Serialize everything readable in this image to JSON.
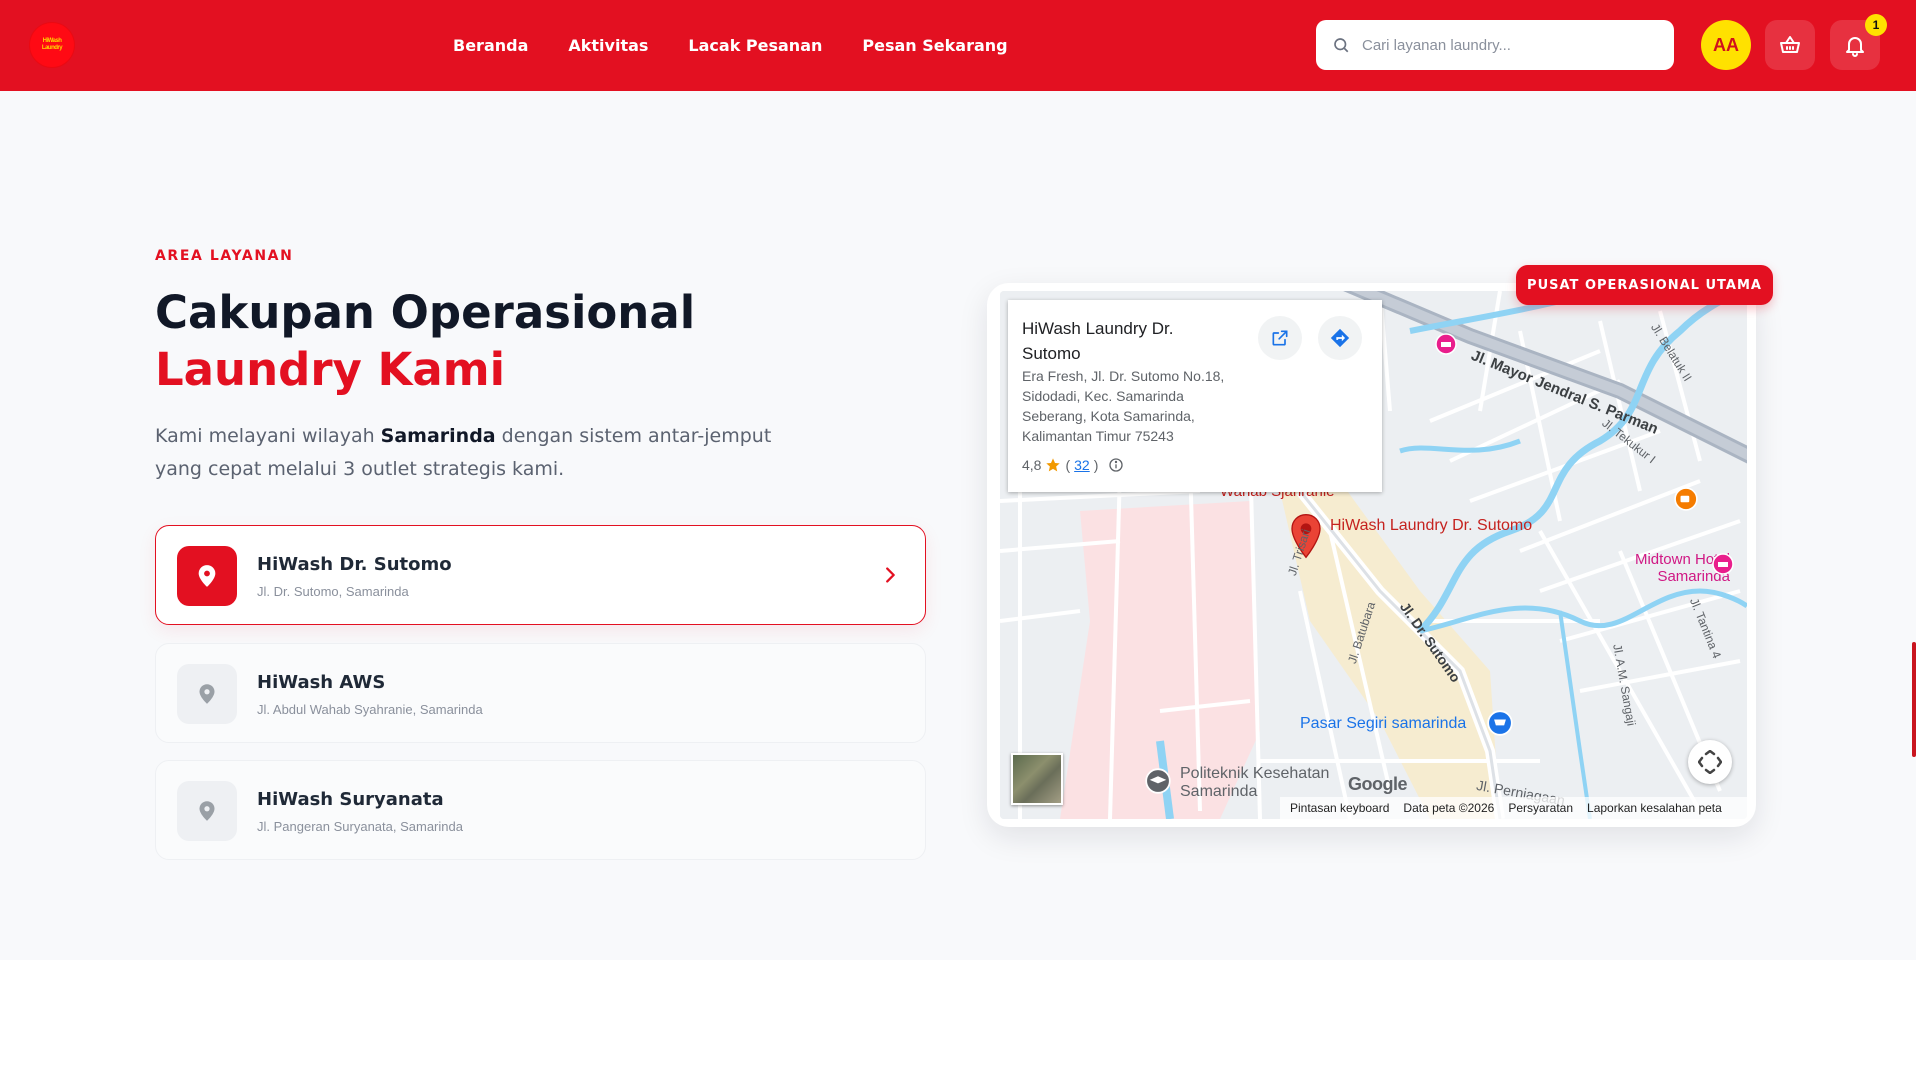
{
  "nav": {
    "logo_text": "HiWash Laundry",
    "menu": [
      "Beranda",
      "Aktivitas",
      "Lacak Pesanan",
      "Pesan Sekarang"
    ],
    "search_placeholder": "Cari layanan laundry...",
    "avatar_initials": "AA",
    "notification_count": "1"
  },
  "section": {
    "eyebrow": "AREA LAYANAN",
    "title_line1": "Cakupan Operasional",
    "title_line2": "Laundry Kami",
    "lead_prefix": "Kami melayani wilayah ",
    "lead_bold": "Samarinda",
    "lead_suffix": " dengan sistem antar-jemput yang cepat melalui 3 outlet strategis kami."
  },
  "outlets": [
    {
      "name": "HiWash Dr. Sutomo",
      "address": "Jl. Dr. Sutomo, Samarinda",
      "active": true
    },
    {
      "name": "HiWash AWS",
      "address": "Jl. Abdul Wahab Syahranie, Samarinda",
      "active": false
    },
    {
      "name": "HiWash Suryanata",
      "address": "Jl. Pangeran Suryanata, Samarinda",
      "active": false
    }
  ],
  "map": {
    "badge": "PUSAT OPERASIONAL UTAMA",
    "info": {
      "name": "HiWash Laundry Dr. Sutomo",
      "address": "Era Fresh, Jl. Dr. Sutomo No.18, Sidodadi, Kec. Samarinda Seberang, Kota Samarinda, Kalimantan Timur 75243",
      "rating": "4,8",
      "reviews": "32"
    },
    "labels": {
      "pin": "HiWash Laundry Dr. Sutomo",
      "street_parman": "Jl. Mayor Jendral S. Parman",
      "street_sutomo": "Jl. Dr. Sutomo",
      "street_batubara": "Jl. Batubara",
      "street_trisari": "Jl. Trisari",
      "street_perniagaan": "Jl. Perniagaan",
      "street_sangaji": "Jl. A.M. Sangaji",
      "street_tantina": "Jl. Tantina 4",
      "street_tekukur": "Jl. Tekukur I",
      "street_belatuk": "Jl. Belatuk II",
      "wahab": "Wahab Sjahranie",
      "hotel": "Midtown Hotel Samarinda",
      "market": "Pasar Segiri samarinda",
      "poltek": "Politeknik Kesehatan Samarinda",
      "google": "Google"
    },
    "footer": [
      "Pintasan keyboard",
      "Data peta ©2026",
      "Persyaratan",
      "Laporkan kesalahan peta"
    ]
  },
  "colors": {
    "brand_red": "#e31021",
    "accent_yellow": "#ffe100"
  }
}
